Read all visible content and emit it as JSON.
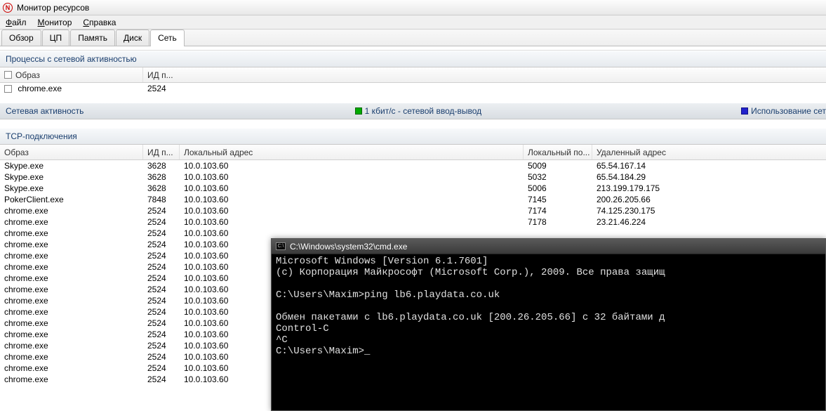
{
  "window": {
    "title": "Монитор ресурсов"
  },
  "menu": {
    "file": "Файл",
    "monitor": "Монитор",
    "help": "Справка"
  },
  "tabs": {
    "overview": "Обзор",
    "cpu": "ЦП",
    "memory": "Память",
    "disk": "Диск",
    "network": "Сеть"
  },
  "panels": {
    "processes": "Процессы с сетевой активностью",
    "activity": "Сетевая активность",
    "activity_legend1": "1 кбит/с - сетевой ввод-вывод",
    "activity_legend2": "Использование сет",
    "tcp": "TCP-подключения"
  },
  "proc_cols": {
    "image": "Образ",
    "pid": "ИД п..."
  },
  "proc_rows": [
    {
      "image": "chrome.exe",
      "pid": "2524"
    }
  ],
  "tcp_cols": {
    "image": "Образ",
    "pid": "ИД п...",
    "local": "Локальный адрес",
    "lport": "Локальный по...",
    "remote": "Удаленный адрес"
  },
  "tcp_rows": [
    {
      "image": "Skype.exe",
      "pid": "3628",
      "local": "10.0.103.60",
      "lport": "5009",
      "remote": "65.54.167.14"
    },
    {
      "image": "Skype.exe",
      "pid": "3628",
      "local": "10.0.103.60",
      "lport": "5032",
      "remote": "65.54.184.29"
    },
    {
      "image": "Skype.exe",
      "pid": "3628",
      "local": "10.0.103.60",
      "lport": "5006",
      "remote": "213.199.179.175"
    },
    {
      "image": "PokerClient.exe",
      "pid": "7848",
      "local": "10.0.103.60",
      "lport": "7145",
      "remote": "200.26.205.66"
    },
    {
      "image": "chrome.exe",
      "pid": "2524",
      "local": "10.0.103.60",
      "lport": "7174",
      "remote": "74.125.230.175"
    },
    {
      "image": "chrome.exe",
      "pid": "2524",
      "local": "10.0.103.60",
      "lport": "7178",
      "remote": "23.21.46.224"
    },
    {
      "image": "chrome.exe",
      "pid": "2524",
      "local": "10.0.103.60",
      "lport": "",
      "remote": ""
    },
    {
      "image": "chrome.exe",
      "pid": "2524",
      "local": "10.0.103.60",
      "lport": "",
      "remote": ""
    },
    {
      "image": "chrome.exe",
      "pid": "2524",
      "local": "10.0.103.60",
      "lport": "",
      "remote": ""
    },
    {
      "image": "chrome.exe",
      "pid": "2524",
      "local": "10.0.103.60",
      "lport": "",
      "remote": ""
    },
    {
      "image": "chrome.exe",
      "pid": "2524",
      "local": "10.0.103.60",
      "lport": "",
      "remote": ""
    },
    {
      "image": "chrome.exe",
      "pid": "2524",
      "local": "10.0.103.60",
      "lport": "",
      "remote": ""
    },
    {
      "image": "chrome.exe",
      "pid": "2524",
      "local": "10.0.103.60",
      "lport": "",
      "remote": ""
    },
    {
      "image": "chrome.exe",
      "pid": "2524",
      "local": "10.0.103.60",
      "lport": "",
      "remote": ""
    },
    {
      "image": "chrome.exe",
      "pid": "2524",
      "local": "10.0.103.60",
      "lport": "",
      "remote": ""
    },
    {
      "image": "chrome.exe",
      "pid": "2524",
      "local": "10.0.103.60",
      "lport": "",
      "remote": ""
    },
    {
      "image": "chrome.exe",
      "pid": "2524",
      "local": "10.0.103.60",
      "lport": "",
      "remote": ""
    },
    {
      "image": "chrome.exe",
      "pid": "2524",
      "local": "10.0.103.60",
      "lport": "",
      "remote": ""
    },
    {
      "image": "chrome.exe",
      "pid": "2524",
      "local": "10.0.103.60",
      "lport": "",
      "remote": ""
    },
    {
      "image": "chrome.exe",
      "pid": "2524",
      "local": "10.0.103.60",
      "lport": "",
      "remote": ""
    }
  ],
  "cmd": {
    "title": "C:\\Windows\\system32\\cmd.exe",
    "lines": [
      "Microsoft Windows [Version 6.1.7601]",
      "(c) Корпорация Майкрософт (Microsoft Corp.), 2009. Все права защищ",
      "",
      "C:\\Users\\Maxim>ping lb6.playdata.co.uk",
      "",
      "Обмен пакетами с lb6.playdata.co.uk [200.26.205.66] с 32 байтами д",
      "Control-C",
      "^C",
      "C:\\Users\\Maxim>_"
    ]
  }
}
